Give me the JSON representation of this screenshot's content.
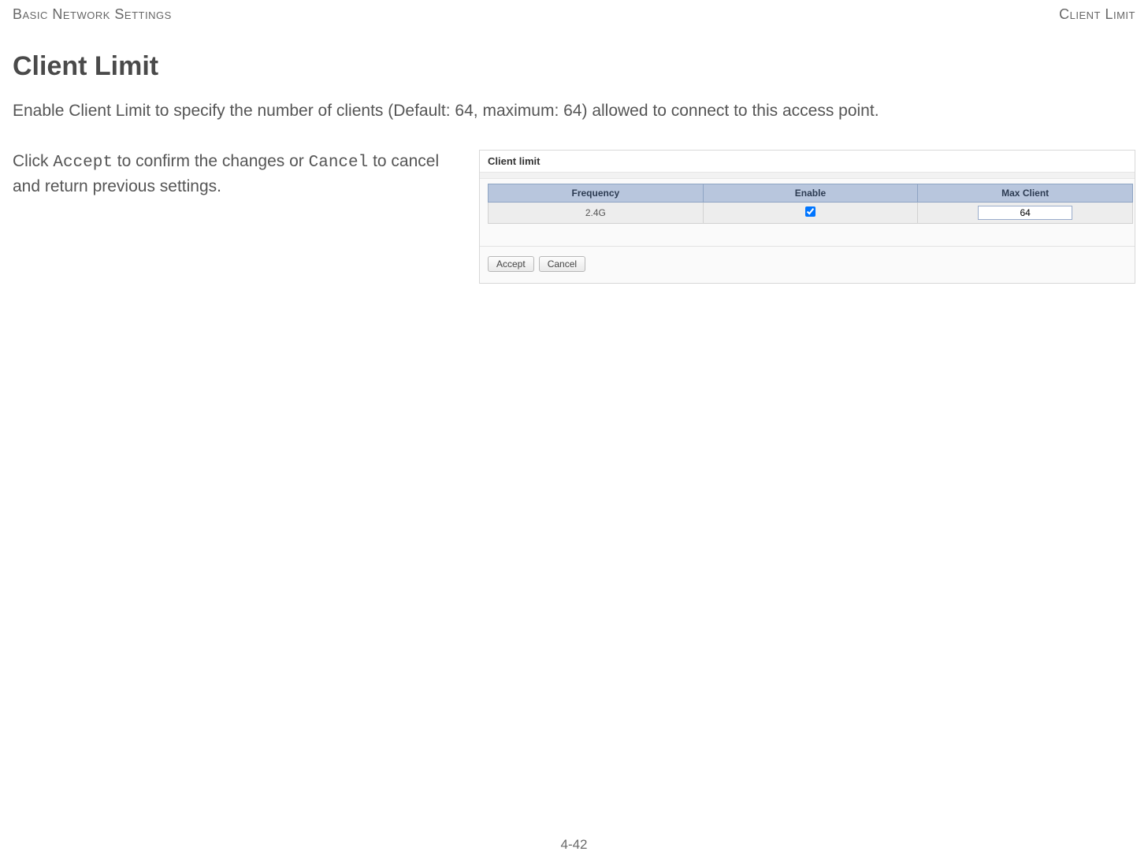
{
  "header": {
    "left": "Basic Network Settings",
    "right": "Client Limit"
  },
  "title": "Client Limit",
  "description": "Enable Client Limit to specify the number of clients (Default: 64, maximum: 64) allowed to connect to this access point.",
  "instruction": {
    "prefix": "Click ",
    "accept": "Accept",
    "mid": " to confirm the changes or ",
    "cancel": "Cancel",
    "suffix": " to cancel and return previous settings."
  },
  "panel": {
    "title": "Client limit",
    "columns": {
      "frequency": "Frequency",
      "enable": "Enable",
      "maxclient": "Max Client"
    },
    "row": {
      "frequency": "2.4G",
      "enable_checked": true,
      "maxclient": "64"
    },
    "buttons": {
      "accept": "Accept",
      "cancel": "Cancel"
    }
  },
  "page_number": "4-42"
}
